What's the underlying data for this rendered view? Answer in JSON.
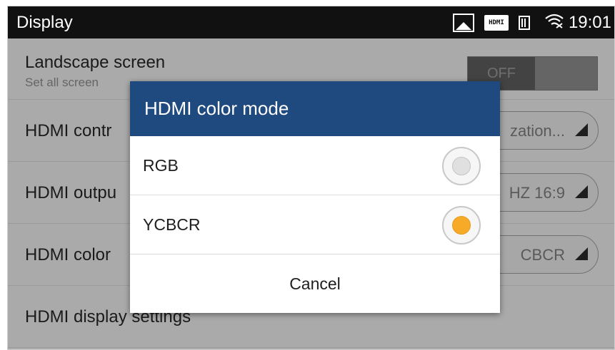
{
  "status_bar": {
    "title": "Display",
    "icons": [
      "image-icon",
      "hdmi-icon",
      "sim-icon",
      "wifi-icon"
    ],
    "hdmi_badge": "HDMI",
    "time": "19:01"
  },
  "settings": {
    "landscape": {
      "label": "Landscape screen",
      "sub": "Set all screen",
      "toggle": "OFF"
    },
    "hdmi_control": {
      "label": "HDMI contr",
      "value": "zation..."
    },
    "hdmi_output": {
      "label": "HDMI outpu",
      "value": "HZ 16:9"
    },
    "hdmi_color": {
      "label": "HDMI color",
      "value": "CBCR"
    },
    "hdmi_display": {
      "label": "HDMI display settings"
    }
  },
  "dialog": {
    "title": "HDMI color mode",
    "options": [
      {
        "label": "RGB",
        "selected": false
      },
      {
        "label": "YCBCR",
        "selected": true
      }
    ],
    "cancel": "Cancel"
  },
  "colors": {
    "accent": "#1f4a7f",
    "radio_selected": "#f7a928",
    "status_bar": "#111111"
  }
}
